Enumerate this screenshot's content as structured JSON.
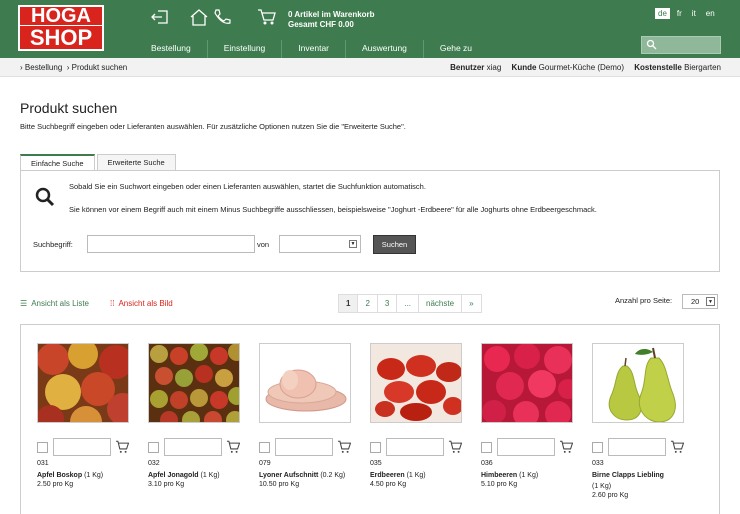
{
  "logo": {
    "line1": "HOGA",
    "line2": "SHOP"
  },
  "header": {
    "cart_count": "0 Artikel im Warenkorb",
    "cart_total": "Gesamt CHF 0.00",
    "languages": [
      {
        "code": "de",
        "active": true
      },
      {
        "code": "fr",
        "active": false
      },
      {
        "code": "it",
        "active": false
      },
      {
        "code": "en",
        "active": false
      }
    ]
  },
  "nav": [
    "Bestellung",
    "Einstellung",
    "Inventar",
    "Auswertung",
    "Gehe zu"
  ],
  "breadcrumb": {
    "parent": "Bestellung",
    "current": "Produkt suchen"
  },
  "userinfo": {
    "user_label": "Benutzer",
    "user": "xiag",
    "customer_label": "Kunde",
    "customer": "Gourmet-Küche (Demo)",
    "cost_label": "Kostenstelle",
    "cost": "Biergarten"
  },
  "page": {
    "title": "Produkt suchen",
    "intro": "Bitte Suchbegriff eingeben oder Lieferanten auswählen. Für zusätzliche Optionen nutzen Sie die \"Erweiterte Suche\"."
  },
  "tabs": [
    "Einfache Suche",
    "Erweiterte Suche"
  ],
  "search": {
    "hint1": "Sobald Sie ein Suchwort eingeben oder einen Lieferanten auswählen, startet die Suchfunktion automatisch.",
    "hint2": "Sie können vor einem Begriff auch mit einem Minus Suchbegriffe ausschliessen, beispielsweise \"Joghurt -Erdbeere\" für alle Joghurts ohne Erdbeergeschmack.",
    "term_label": "Suchbegriff:",
    "from_label": "von",
    "button": "Suchen"
  },
  "views": {
    "list": "Ansicht als Liste",
    "image": "Ansicht als Bild"
  },
  "pager": [
    "1",
    "2",
    "3",
    "...",
    "nächste",
    "»"
  ],
  "perpage": {
    "label": "Anzahl pro Seite:",
    "value": "20"
  },
  "products": [
    {
      "num": "031",
      "name": "Apfel Boskop",
      "unit": "(1 Kg)",
      "price": "2.50 pro Kg",
      "img": "apple-red"
    },
    {
      "num": "032",
      "name": "Apfel Jonagold",
      "unit": "(1 Kg)",
      "price": "3.10 pro Kg",
      "img": "apple-mix"
    },
    {
      "num": "079",
      "name": "Lyoner Aufschnitt",
      "unit": "(0.2 Kg)",
      "price": "10.50 pro Kg",
      "img": "sausage"
    },
    {
      "num": "035",
      "name": "Erdbeeren",
      "unit": "(1 Kg)",
      "price": "4.50 pro Kg",
      "img": "strawberry"
    },
    {
      "num": "036",
      "name": "Himbeeren",
      "unit": "(1 Kg)",
      "price": "5.10 pro Kg",
      "img": "raspberry"
    },
    {
      "num": "033",
      "name": "Birne Clapps Liebling",
      "unit": "(1 Kg)",
      "price": "2.60 pro Kg",
      "img": "pear"
    }
  ]
}
